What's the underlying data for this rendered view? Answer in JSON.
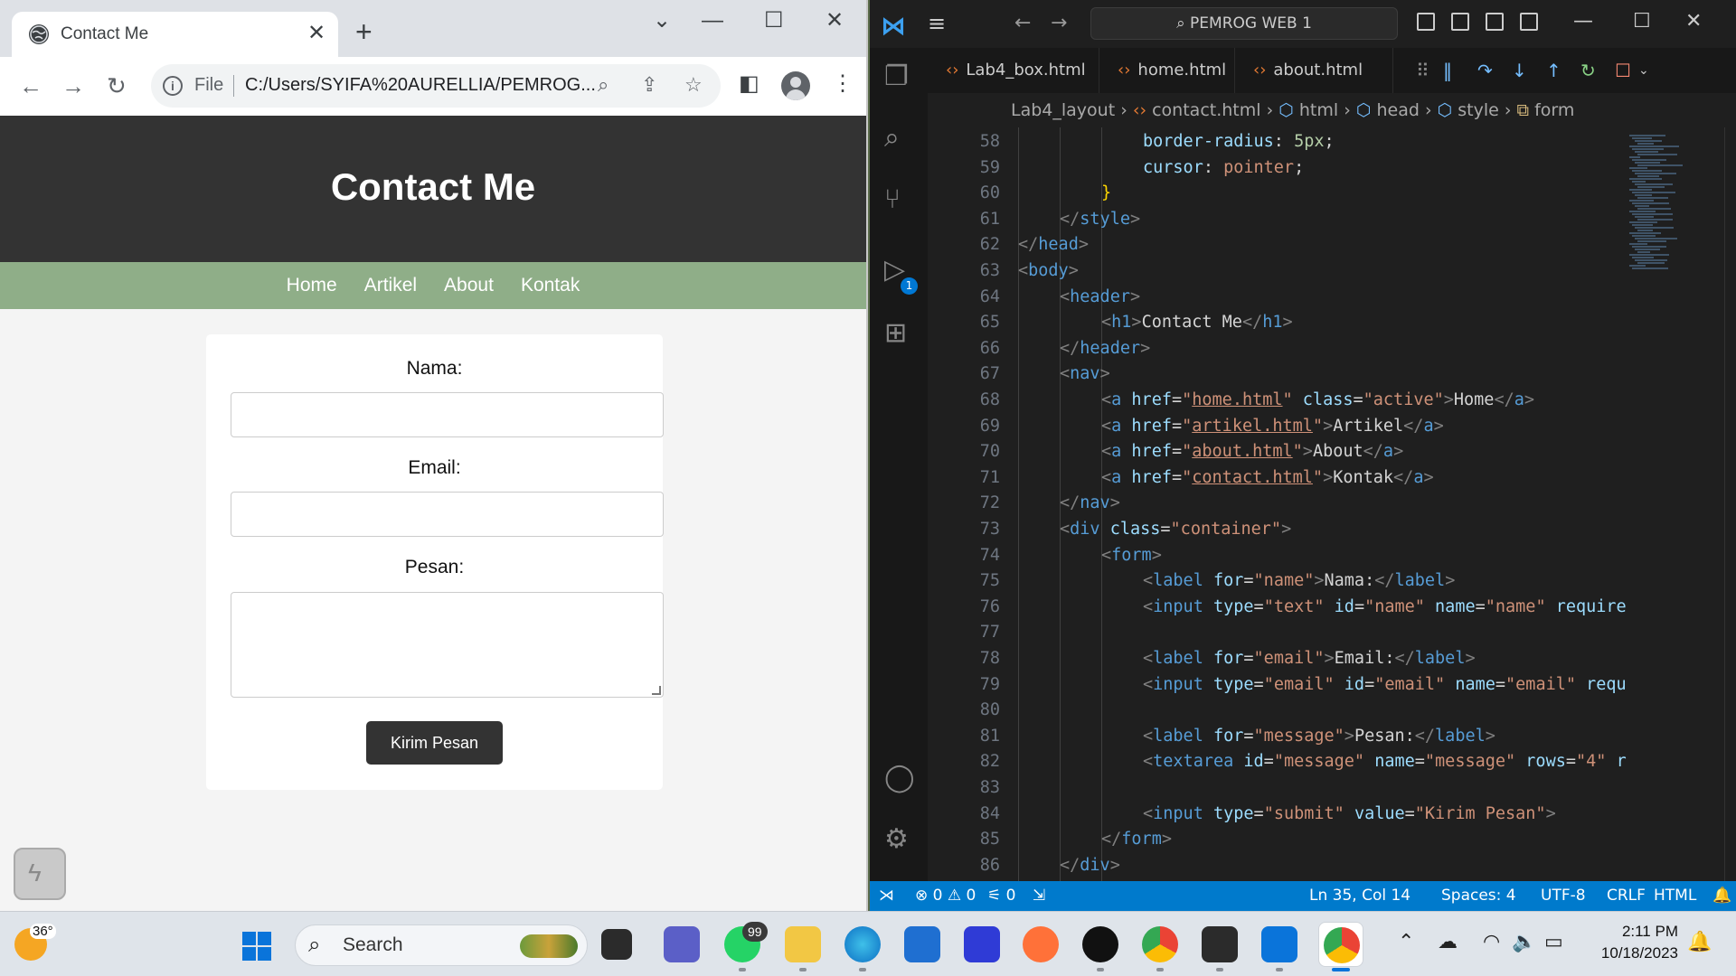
{
  "browser": {
    "tab_title": "Contact Me",
    "tab_close": "✕",
    "new_tab": "+",
    "window_controls": [
      "⌄",
      "—",
      "☐",
      "✕"
    ],
    "nav": {
      "back": "←",
      "forward": "→",
      "reload": "↻"
    },
    "omnibox": {
      "info": "i",
      "scheme_label": "File",
      "url": "C:/Users/SYIFA%20AURELLIA/PEMROG..."
    },
    "omnibox_icons": [
      "zoom-icon",
      "share-icon",
      "star-icon"
    ],
    "toolbar_icons": [
      "side-panel-icon",
      "profile-icon",
      "menu-icon"
    ]
  },
  "page": {
    "header_title": "Contact Me",
    "nav_links": [
      "Home",
      "Artikel",
      "About",
      "Kontak"
    ],
    "form": {
      "name_label": "Nama:",
      "email_label": "Email:",
      "message_label": "Pesan:",
      "name_value": "",
      "email_value": "",
      "message_value": "",
      "submit_label": "Kirim Pesan"
    }
  },
  "vscode": {
    "command_center": "PEMROG WEB 1",
    "tabs": [
      "Lab4_box.html",
      "home.html",
      "about.html"
    ],
    "breadcrumb": [
      "Lab4_layout",
      "contact.html",
      "html",
      "head",
      "style",
      "form"
    ],
    "debug_badge": "1",
    "code_lines": [
      {
        "n": "58",
        "indent": 3,
        "html": "<span class='an'>border-radius</span><span class='tx'>: </span><span class='num'>5px</span><span class='tx'>;</span>"
      },
      {
        "n": "59",
        "indent": 3,
        "html": "<span class='an'>cursor</span><span class='tx'>: </span><span class='av'>pointer</span><span class='tx'>;</span>"
      },
      {
        "n": "60",
        "indent": 2,
        "html": "<span class='pn'>}</span>"
      },
      {
        "n": "61",
        "indent": 1,
        "html": "<span class='tg'>&lt;/</span><span class='tn'>style</span><span class='tg'>&gt;</span>"
      },
      {
        "n": "62",
        "indent": 0,
        "html": "<span class='tg'>&lt;/</span><span class='tn'>head</span><span class='tg'>&gt;</span>"
      },
      {
        "n": "63",
        "indent": 0,
        "html": "<span class='tg'>&lt;</span><span class='tn'>body</span><span class='tg'>&gt;</span>"
      },
      {
        "n": "64",
        "indent": 1,
        "html": "<span class='tg'>&lt;</span><span class='tn'>header</span><span class='tg'>&gt;</span>"
      },
      {
        "n": "65",
        "indent": 2,
        "html": "<span class='tg'>&lt;</span><span class='tn'>h1</span><span class='tg'>&gt;</span><span class='tx'>Contact Me</span><span class='tg'>&lt;/</span><span class='tn'>h1</span><span class='tg'>&gt;</span>"
      },
      {
        "n": "66",
        "indent": 1,
        "html": "<span class='tg'>&lt;/</span><span class='tn'>header</span><span class='tg'>&gt;</span>"
      },
      {
        "n": "67",
        "indent": 1,
        "html": "<span class='tg'>&lt;</span><span class='tn'>nav</span><span class='tg'>&gt;</span>"
      },
      {
        "n": "68",
        "indent": 2,
        "html": "<span class='tg'>&lt;</span><span class='tn'>a</span> <span class='an'>href</span><span class='tx'>=</span><span class='av'>\"<span class='ul'>home.html</span>\"</span> <span class='an'>class</span><span class='tx'>=</span><span class='av'>\"active\"</span><span class='tg'>&gt;</span><span class='tx'>Home</span><span class='tg'>&lt;/</span><span class='tn'>a</span><span class='tg'>&gt;</span>"
      },
      {
        "n": "69",
        "indent": 2,
        "html": "<span class='tg'>&lt;</span><span class='tn'>a</span> <span class='an'>href</span><span class='tx'>=</span><span class='av'>\"<span class='ul'>artikel.html</span>\"</span><span class='tg'>&gt;</span><span class='tx'>Artikel</span><span class='tg'>&lt;/</span><span class='tn'>a</span><span class='tg'>&gt;</span>"
      },
      {
        "n": "70",
        "indent": 2,
        "html": "<span class='tg'>&lt;</span><span class='tn'>a</span> <span class='an'>href</span><span class='tx'>=</span><span class='av'>\"<span class='ul'>about.html</span>\"</span><span class='tg'>&gt;</span><span class='tx'>About</span><span class='tg'>&lt;/</span><span class='tn'>a</span><span class='tg'>&gt;</span>"
      },
      {
        "n": "71",
        "indent": 2,
        "html": "<span class='tg'>&lt;</span><span class='tn'>a</span> <span class='an'>href</span><span class='tx'>=</span><span class='av'>\"<span class='ul'>contact.html</span>\"</span><span class='tg'>&gt;</span><span class='tx'>Kontak</span><span class='tg'>&lt;/</span><span class='tn'>a</span><span class='tg'>&gt;</span>"
      },
      {
        "n": "72",
        "indent": 1,
        "html": "<span class='tg'>&lt;/</span><span class='tn'>nav</span><span class='tg'>&gt;</span>"
      },
      {
        "n": "73",
        "indent": 1,
        "html": "<span class='tg'>&lt;</span><span class='tn'>div</span> <span class='an'>class</span><span class='tx'>=</span><span class='av'>\"container\"</span><span class='tg'>&gt;</span>"
      },
      {
        "n": "74",
        "indent": 2,
        "html": "<span class='tg'>&lt;</span><span class='tn'>form</span><span class='tg'>&gt;</span>"
      },
      {
        "n": "75",
        "indent": 3,
        "html": "<span class='tg'>&lt;</span><span class='tn'>label</span> <span class='an'>for</span><span class='tx'>=</span><span class='av'>\"name\"</span><span class='tg'>&gt;</span><span class='tx'>Nama:</span><span class='tg'>&lt;/</span><span class='tn'>label</span><span class='tg'>&gt;</span>"
      },
      {
        "n": "76",
        "indent": 3,
        "html": "<span class='tg'>&lt;</span><span class='tn'>input</span> <span class='an'>type</span><span class='tx'>=</span><span class='av'>\"text\"</span> <span class='an'>id</span><span class='tx'>=</span><span class='av'>\"name\"</span> <span class='an'>name</span><span class='tx'>=</span><span class='av'>\"name\"</span> <span class='an'>require</span>"
      },
      {
        "n": "77",
        "indent": 0,
        "html": ""
      },
      {
        "n": "78",
        "indent": 3,
        "html": "<span class='tg'>&lt;</span><span class='tn'>label</span> <span class='an'>for</span><span class='tx'>=</span><span class='av'>\"email\"</span><span class='tg'>&gt;</span><span class='tx'>Email:</span><span class='tg'>&lt;/</span><span class='tn'>label</span><span class='tg'>&gt;</span>"
      },
      {
        "n": "79",
        "indent": 3,
        "html": "<span class='tg'>&lt;</span><span class='tn'>input</span> <span class='an'>type</span><span class='tx'>=</span><span class='av'>\"email\"</span> <span class='an'>id</span><span class='tx'>=</span><span class='av'>\"email\"</span> <span class='an'>name</span><span class='tx'>=</span><span class='av'>\"email\"</span> <span class='an'>requ</span>"
      },
      {
        "n": "80",
        "indent": 0,
        "html": ""
      },
      {
        "n": "81",
        "indent": 3,
        "html": "<span class='tg'>&lt;</span><span class='tn'>label</span> <span class='an'>for</span><span class='tx'>=</span><span class='av'>\"message\"</span><span class='tg'>&gt;</span><span class='tx'>Pesan:</span><span class='tg'>&lt;/</span><span class='tn'>label</span><span class='tg'>&gt;</span>"
      },
      {
        "n": "82",
        "indent": 3,
        "html": "<span class='tg'>&lt;</span><span class='tn'>textarea</span> <span class='an'>id</span><span class='tx'>=</span><span class='av'>\"message\"</span> <span class='an'>name</span><span class='tx'>=</span><span class='av'>\"message\"</span> <span class='an'>rows</span><span class='tx'>=</span><span class='av'>\"4\"</span> <span class='an'>r</span>"
      },
      {
        "n": "83",
        "indent": 0,
        "html": ""
      },
      {
        "n": "84",
        "indent": 3,
        "html": "<span class='tg'>&lt;</span><span class='tn'>input</span> <span class='an'>type</span><span class='tx'>=</span><span class='av'>\"submit\"</span> <span class='an'>value</span><span class='tx'>=</span><span class='av'>\"Kirim Pesan\"</span><span class='tg'>&gt;</span>"
      },
      {
        "n": "85",
        "indent": 2,
        "html": "<span class='tg'>&lt;/</span><span class='tn'>form</span><span class='tg'>&gt;</span>"
      },
      {
        "n": "86",
        "indent": 1,
        "html": "<span class='tg'>&lt;/</span><span class='tn'>div</span><span class='tg'>&gt;</span>"
      }
    ],
    "status": {
      "errors": "0",
      "warnings": "0",
      "ports": "0",
      "position": "Ln 35, Col 14",
      "spaces": "Spaces: 4",
      "encoding": "UTF-8",
      "eol": "CRLF",
      "language": "HTML"
    }
  },
  "taskbar": {
    "weather_temp": "36°",
    "search_placeholder": "Search",
    "whatsapp_badge": "99",
    "time": "2:11 PM",
    "date": "10/18/2023"
  },
  "colors": {
    "site_header": "#333333",
    "site_nav": "#8fae88",
    "vscode_status": "#007acc"
  }
}
